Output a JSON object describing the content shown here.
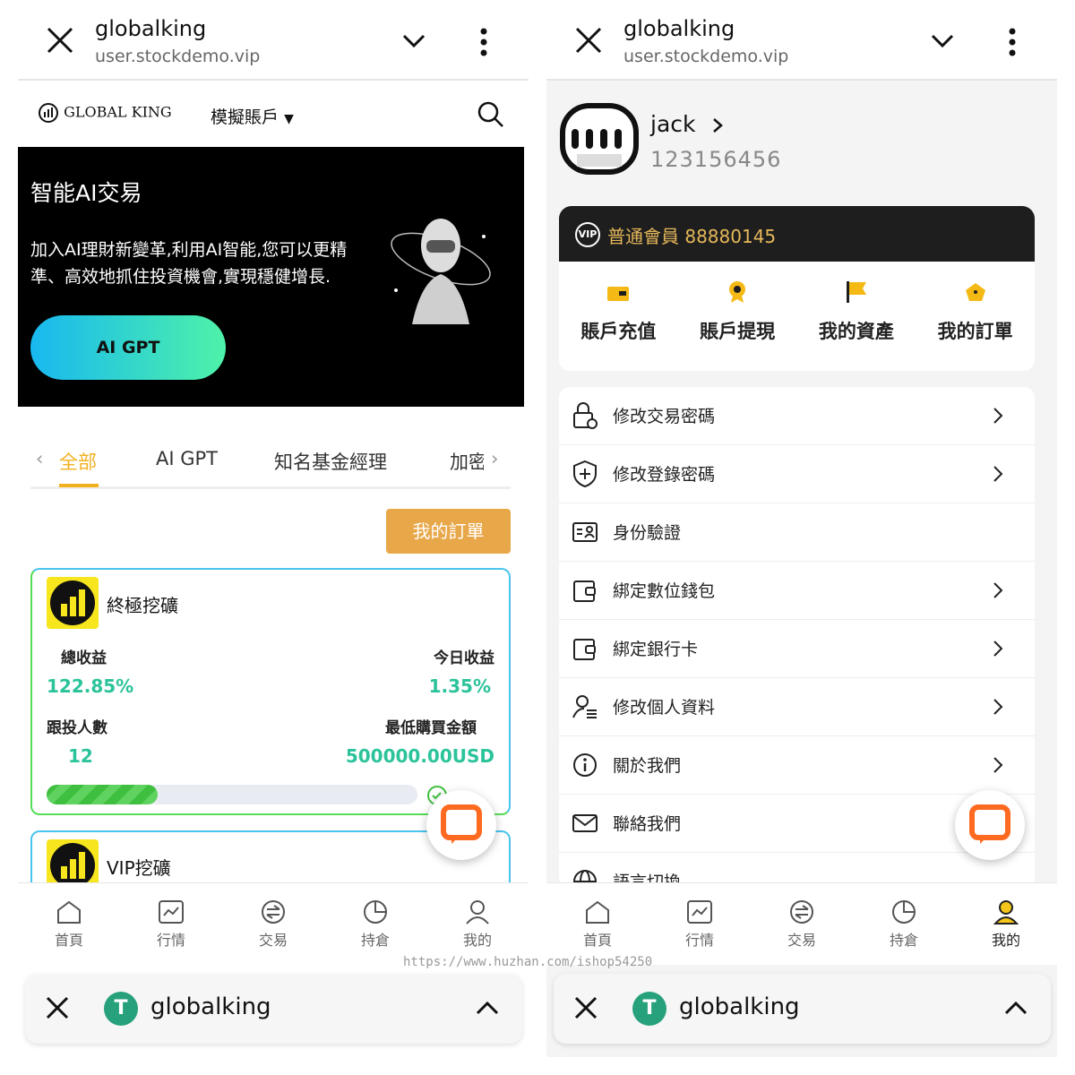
{
  "browser": {
    "title": "globalking",
    "url": "user.stockdemo.vip"
  },
  "left": {
    "brand": "GLOBAL KING",
    "account_label": "模擬賬戶",
    "banner": {
      "heading": "智能AI交易",
      "text": "加入AI理財新變革,利用AI智能,您可以更精準、高效地抓住投資機會,實現穩健增長.",
      "button": "AI GPT"
    },
    "tabs": [
      "全部",
      "AI GPT",
      "知名基金經理",
      "加密"
    ],
    "my_orders": "我的訂單",
    "card1": {
      "name": "終極挖礦",
      "total_label": "總收益",
      "total_value": "122.85%",
      "today_label": "今日收益",
      "today_value": "1.35%",
      "followers_label": "跟投人數",
      "followers_value": "12",
      "min_label": "最低購買金額",
      "min_value": "500000.00USD",
      "progress": 0.3
    },
    "card2": {
      "name": "VIP挖礦"
    }
  },
  "right": {
    "username": "jack",
    "user_id": "123156456",
    "vip_badge": "VIP",
    "vip_text": "普通會員 88880145",
    "quick": [
      "賬戶充值",
      "賬戶提現",
      "我的資產",
      "我的訂單"
    ],
    "menu": [
      "修改交易密碼",
      "修改登錄密碼",
      "身份驗證",
      "綁定數位錢包",
      "綁定銀行卡",
      "修改個人資料",
      "關於我們",
      "聯絡我們",
      "語言切換"
    ]
  },
  "nav": [
    "首頁",
    "行情",
    "交易",
    "持倉",
    "我的"
  ],
  "bottom_bar": {
    "name": "globalking",
    "logo_glyph": "T"
  },
  "watermark": "https://www.huzhan.com/ishop54250",
  "colors": {
    "accent": "#f2b01e",
    "green": "#2bc39a",
    "livechat": "#ff6a21",
    "tether": "#26a17b"
  }
}
